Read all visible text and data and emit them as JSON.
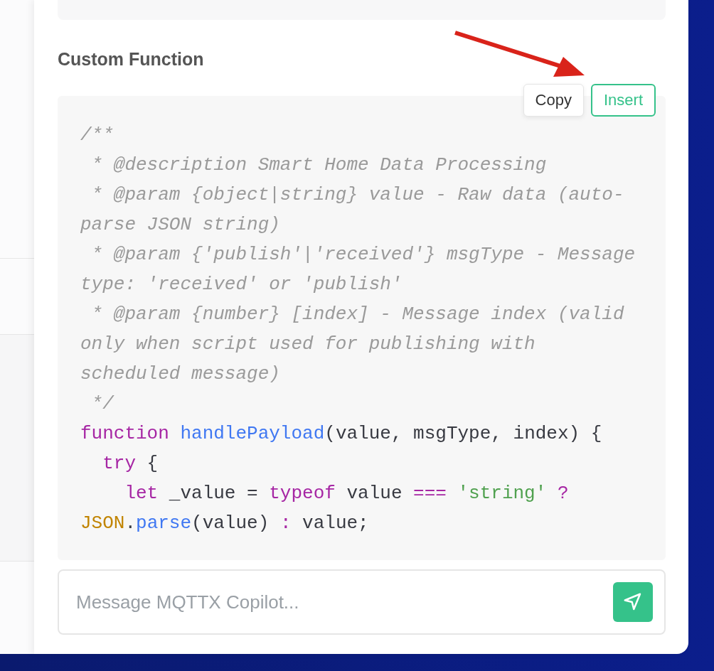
{
  "section": {
    "title": "Custom Function"
  },
  "code_block": {
    "actions": [
      {
        "label": "Copy",
        "kind": "plain"
      },
      {
        "label": "Insert",
        "kind": "primary"
      }
    ],
    "lines": [
      {
        "tokens": [
          {
            "kind": "comment",
            "text": "/**"
          }
        ]
      },
      {
        "tokens": [
          {
            "kind": "comment",
            "text": " * @description Smart Home Data Processing"
          }
        ]
      },
      {
        "tokens": [
          {
            "kind": "comment",
            "text": " * @param {object|string} value - Raw data (auto-"
          }
        ]
      },
      {
        "tokens": [
          {
            "kind": "comment",
            "text": "parse JSON string)"
          }
        ]
      },
      {
        "tokens": [
          {
            "kind": "comment",
            "text": " * @param {'publish'|'received'} msgType - Message"
          }
        ]
      },
      {
        "tokens": [
          {
            "kind": "comment",
            "text": "type: 'received' or 'publish'"
          }
        ]
      },
      {
        "tokens": [
          {
            "kind": "comment",
            "text": " * @param {number} [index] - Message index (valid"
          }
        ]
      },
      {
        "tokens": [
          {
            "kind": "comment",
            "text": "only when script used for publishing with"
          }
        ]
      },
      {
        "tokens": [
          {
            "kind": "comment",
            "text": "scheduled message)"
          }
        ]
      },
      {
        "tokens": [
          {
            "kind": "comment",
            "text": " */"
          }
        ]
      },
      {
        "tokens": [
          {
            "kind": "keyword",
            "text": "function "
          },
          {
            "kind": "function",
            "text": "handlePayload"
          },
          {
            "kind": "plain",
            "text": "(value, msgType, index) {"
          }
        ]
      },
      {
        "tokens": [
          {
            "kind": "keyword",
            "text": "  try"
          },
          {
            "kind": "plain",
            "text": " {"
          }
        ]
      },
      {
        "tokens": [
          {
            "kind": "keyword",
            "text": "    let"
          },
          {
            "kind": "plain",
            "text": " _value = "
          },
          {
            "kind": "keyword",
            "text": "typeof"
          },
          {
            "kind": "plain",
            "text": " value "
          },
          {
            "kind": "keyword",
            "text": "==="
          },
          {
            "kind": "string",
            "text": " 'string'"
          },
          {
            "kind": "keyword",
            "text": " ?"
          }
        ]
      },
      {
        "tokens": [
          {
            "kind": "builtin",
            "text": "JSON"
          },
          {
            "kind": "plain",
            "text": "."
          },
          {
            "kind": "function",
            "text": "parse"
          },
          {
            "kind": "plain",
            "text": "(value) "
          },
          {
            "kind": "keyword",
            "text": ":"
          },
          {
            "kind": "plain",
            "text": " value;"
          }
        ]
      }
    ]
  },
  "message_input": {
    "placeholder": "Message MQTTX Copilot..."
  }
}
